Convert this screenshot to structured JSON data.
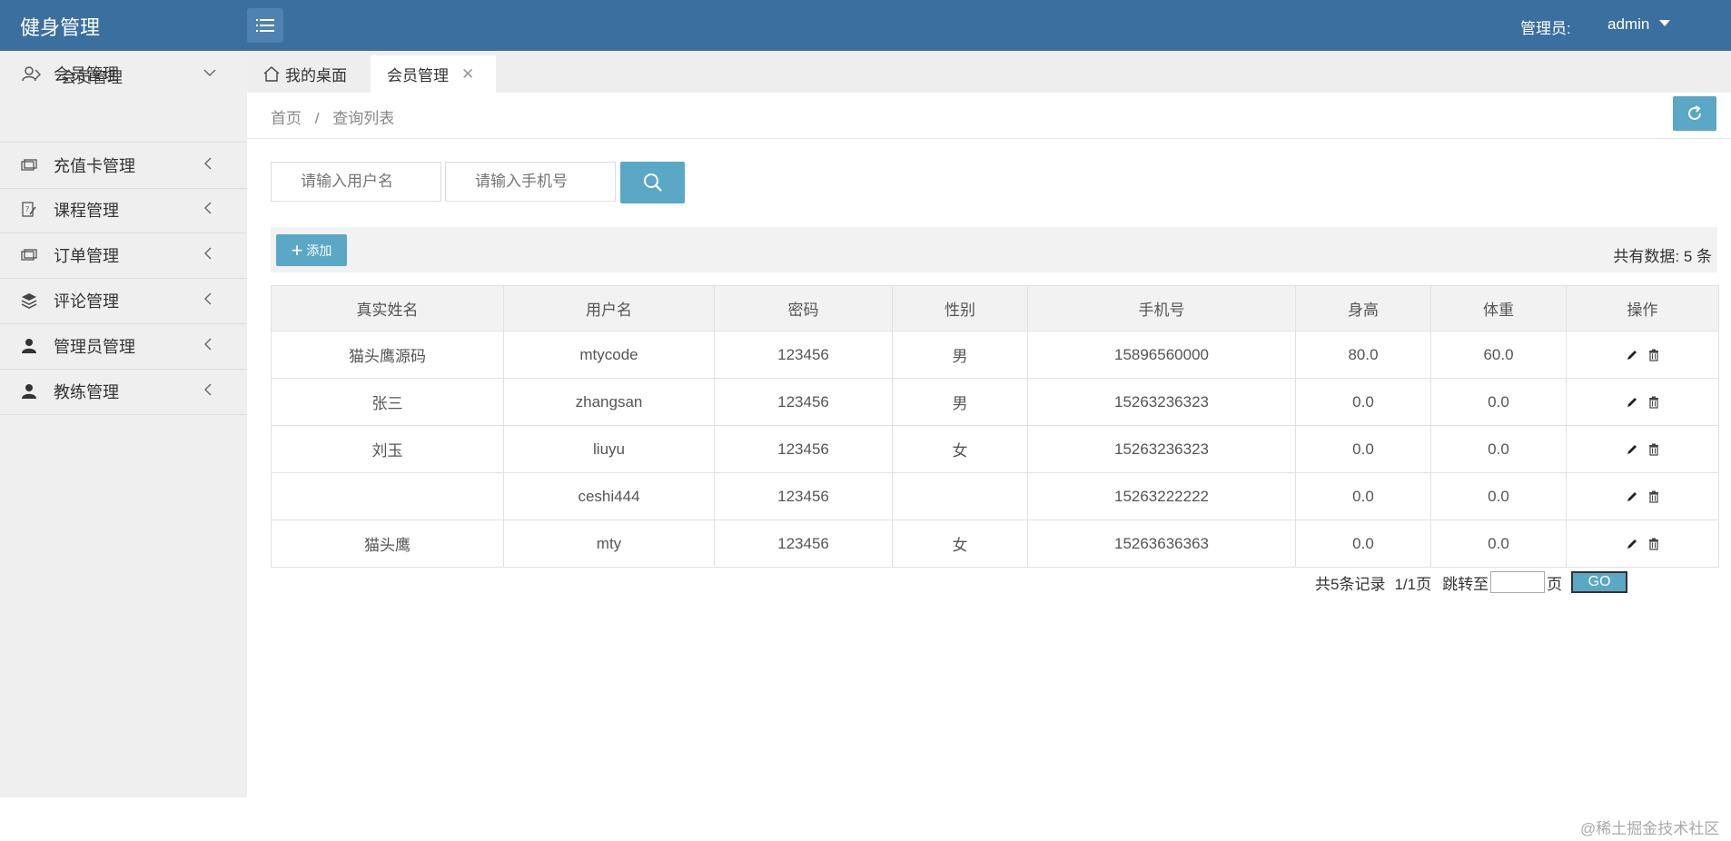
{
  "header": {
    "app_title": "健身管理",
    "admin_label": "管理员:",
    "admin_name": "admin"
  },
  "sidebar": {
    "items": [
      {
        "label": "会员管理",
        "icon": "user-icon",
        "expanded": true
      },
      {
        "label": "充值卡管理",
        "icon": "card-icon"
      },
      {
        "label": "课程管理",
        "icon": "course-icon"
      },
      {
        "label": "订单管理",
        "icon": "order-icon"
      },
      {
        "label": "评论管理",
        "icon": "layers-icon"
      },
      {
        "label": "管理员管理",
        "icon": "person-icon"
      },
      {
        "label": "教练管理",
        "icon": "person-icon"
      }
    ],
    "subitems": [
      {
        "label": "会员管理"
      }
    ]
  },
  "tabs": {
    "home_label": "我的桌面",
    "active_label": "会员管理"
  },
  "breadcrumb": {
    "home": "首页",
    "separator": "/",
    "current": "查询列表"
  },
  "search": {
    "username_placeholder": "请输入用户名",
    "phone_placeholder": "请输入手机号"
  },
  "toolbar": {
    "add_label": "添加",
    "total_text": "共有数据: 5 条"
  },
  "table": {
    "columns": [
      "真实姓名",
      "用户名",
      "密码",
      "性别",
      "手机号",
      "身高",
      "体重",
      "操作"
    ],
    "rows": [
      [
        "猫头鹰源码",
        "mtycode",
        "123456",
        "男",
        "15896560000",
        "80.0",
        "60.0"
      ],
      [
        "张三",
        "zhangsan",
        "123456",
        "男",
        "15263236323",
        "0.0",
        "0.0"
      ],
      [
        "刘玉",
        "liuyu",
        "123456",
        "女",
        "15263236323",
        "0.0",
        "0.0"
      ],
      [
        "",
        "ceshi444",
        "123456",
        "",
        "15263222222",
        "0.0",
        "0.0"
      ],
      [
        "猫头鹰",
        "mty",
        "123456",
        "女",
        "15263636363",
        "0.0",
        "0.0"
      ]
    ]
  },
  "pagination": {
    "records_text": "共5条记录",
    "pages_text": "1/1页",
    "jump_label": "跳转至",
    "page_unit": "页",
    "go_label": "GO"
  },
  "footer": {
    "mark": "@稀土掘金技术社区"
  },
  "colors": {
    "header_bg": "#3a6f9f",
    "accent": "#5aa7c6",
    "sidebar_bg": "#efefef"
  }
}
